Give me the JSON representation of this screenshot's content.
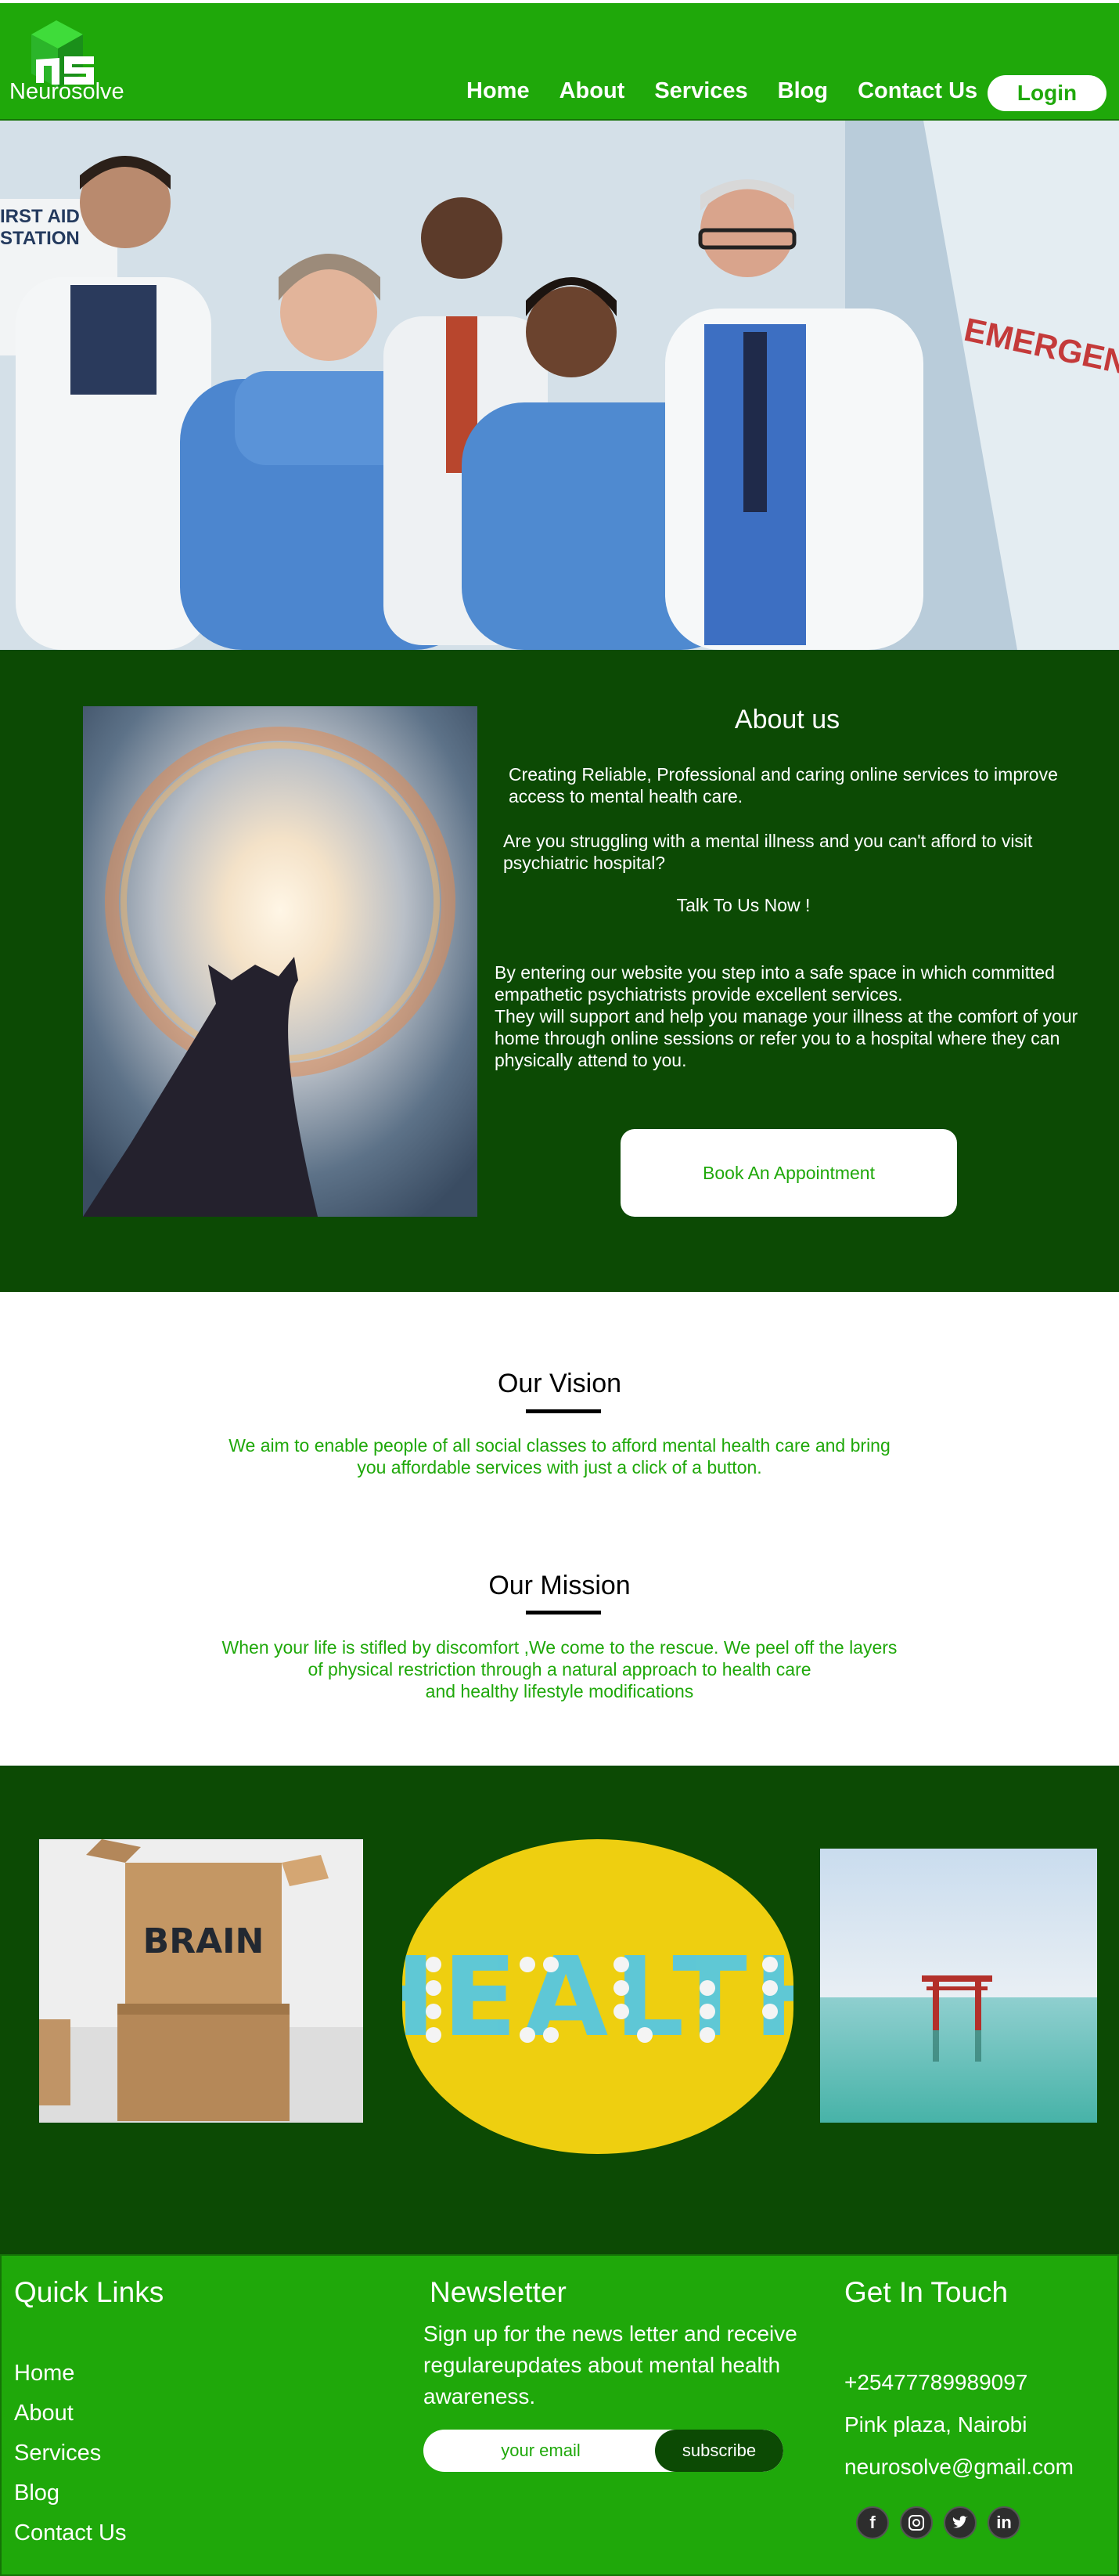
{
  "brand": {
    "name": "Neurosolve",
    "logo_text": "NS"
  },
  "nav": {
    "links": [
      "Home",
      "About",
      "Services",
      "Blog",
      "Contact Us"
    ],
    "login_label": "Login"
  },
  "hero": {
    "sign_left": "FIRST AID STATION",
    "sign_right": "EMERGENCY"
  },
  "about": {
    "title": "About us",
    "p1": "Creating Reliable, Professional and caring online services to improve access to mental health care.",
    "p2": "Are you struggling with a mental illness and you can't afford to visit psychiatric hospital?",
    "p3": "Talk To Us Now !",
    "p4": "By entering our website you step into a safe space in which committed empathetic psychiatrists provide excellent services.",
    "p5": "They will support and help you manage your illness at the comfort of your home through online sessions or refer you to a hospital where they can physically attend to you.",
    "button": "Book An Appointment"
  },
  "vision": {
    "title": "Our Vision",
    "line1": "We aim to enable people of all social classes to afford mental health care and bring",
    "line2": "you affordable services with just a click of a button."
  },
  "mission": {
    "title": "Our Mission",
    "line1": "When your life is stifled by discomfort ,We come to the rescue. We peel off the layers",
    "line2": "of physical restriction through a natural approach to health care",
    "line3": "and healthy lifestyle modifications"
  },
  "gallery": {
    "box_label": "BRAIN",
    "pills_label": "HEALTH"
  },
  "footer": {
    "quick_links_title": "Quick Links",
    "quick_links": [
      "Home",
      "About",
      "Services",
      "Blog",
      "Contact Us"
    ],
    "newsletter_title": "Newsletter",
    "newsletter_line1": "Sign up for the news letter and receive",
    "newsletter_line2": "regulareupdates about mental health",
    "newsletter_line3": "awareness.",
    "email_placeholder": "your email",
    "subscribe_label": "subscribe",
    "contact_title": "Get In Touch",
    "phone": "+25477789989097",
    "address": "Pink plaza, Nairobi",
    "email": "neurosolve@gmail.com",
    "social": [
      "f",
      "in"
    ]
  },
  "colors": {
    "primary_green": "#1fa80a",
    "dark_green": "#0c4a04",
    "white": "#ffffff"
  }
}
